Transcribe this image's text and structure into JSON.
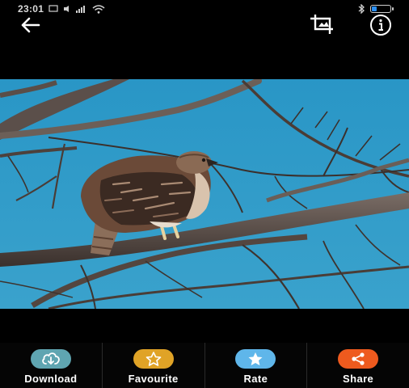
{
  "status_bar": {
    "time": "23:01",
    "icons": [
      "cast-icon",
      "mute-icon",
      "signal-icon",
      "wifi-icon",
      "bluetooth-icon",
      "battery-icon"
    ],
    "battery_level": 0.35,
    "battery_color": "#2b8ff2"
  },
  "top_bar": {
    "back_icon": "arrow-left-icon",
    "crop_icon": "crop-icon",
    "info_icon": "info-icon"
  },
  "image": {
    "subject": "hawk-on-branch",
    "sky_color": "#2c95c3"
  },
  "actions": [
    {
      "label": "Download",
      "icon": "download-cloud-icon",
      "color": "#5fa5b1"
    },
    {
      "label": "Favourite",
      "icon": "star-outline-icon",
      "color": "#e0a326"
    },
    {
      "label": "Rate",
      "icon": "star-filled-icon",
      "color": "#5fb6ea"
    },
    {
      "label": "Share",
      "icon": "share-icon",
      "color": "#ee5a1e"
    }
  ]
}
